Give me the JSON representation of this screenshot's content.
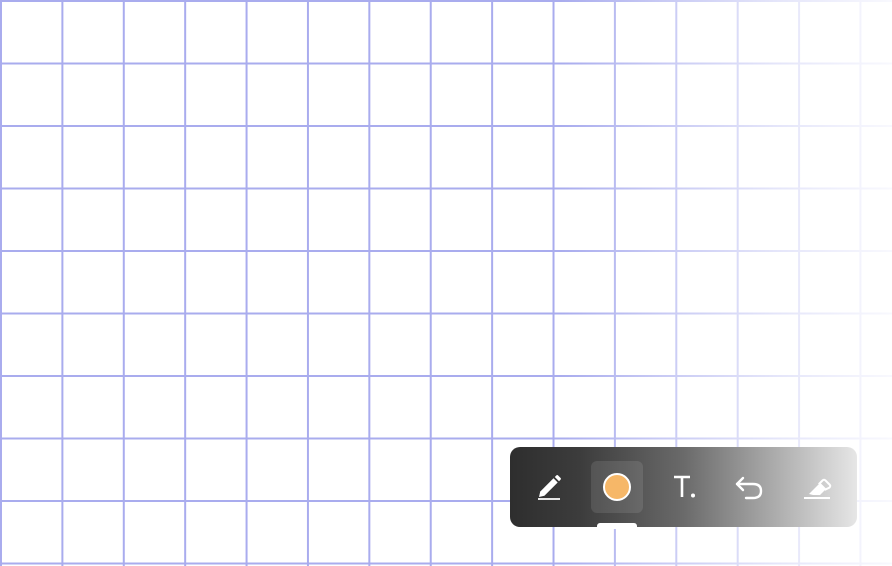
{
  "canvas": {
    "type": "grid-paper",
    "grid_line_color": "#a9acee",
    "background_color": "#ffffff"
  },
  "toolbar": {
    "tools": [
      {
        "id": "pencil",
        "icon": "pencil-icon",
        "active": false
      },
      {
        "id": "color",
        "icon": "color-swatch-icon",
        "active": true,
        "color": "#f6b768"
      },
      {
        "id": "text",
        "icon": "text-tool-icon",
        "active": false
      },
      {
        "id": "undo",
        "icon": "undo-icon",
        "active": false
      },
      {
        "id": "eraser",
        "icon": "eraser-icon",
        "active": false
      }
    ],
    "colors": {
      "icon": "#ffffff",
      "active_indicator": "#ffffff"
    }
  }
}
